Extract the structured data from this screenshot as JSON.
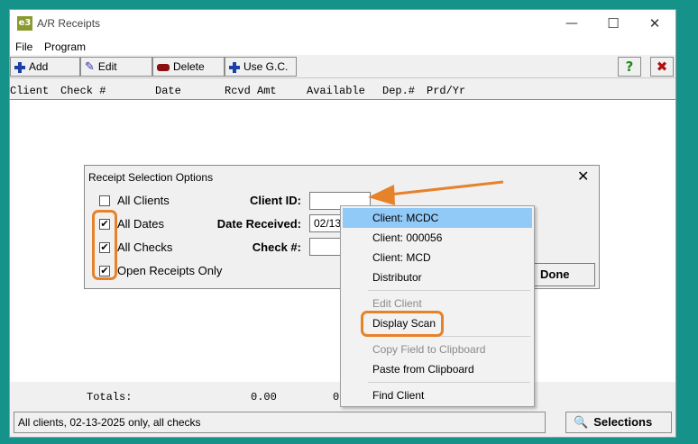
{
  "window": {
    "title": "A/R Receipts",
    "icon_text": "e3",
    "minimize": "—",
    "maximize": "☐",
    "close": "✕"
  },
  "menu": [
    "File",
    "Program"
  ],
  "toolbar": {
    "add": "Add",
    "edit": "Edit",
    "delete": "Delete",
    "use_gc": "Use G.C.",
    "help": "?",
    "exit": "✖"
  },
  "columns": [
    "Client",
    "Check #",
    "Date",
    "Rcvd Amt",
    "Available",
    "Dep.#",
    "Prd/Yr"
  ],
  "totals": {
    "label": "Totals:",
    "rcvd": "0.00",
    "available_partial": "0"
  },
  "status": {
    "text": "All clients, 02-13-2025 only, all checks",
    "selections": "Selections"
  },
  "dialog": {
    "title": "Receipt Selection Options",
    "close": "✕",
    "checkboxes": [
      {
        "label": "All Clients",
        "checked": false
      },
      {
        "label": "All Dates",
        "checked": true
      },
      {
        "label": "All Checks",
        "checked": true
      },
      {
        "label": "Open Receipts Only",
        "checked": true
      }
    ],
    "client_id_label": "Client ID:",
    "client_id_value": "",
    "date_received_label": "Date Received:",
    "date_received_value": "02/13",
    "check_label": "Check #:",
    "check_value": "",
    "done": "Done"
  },
  "context_menu": {
    "items": [
      {
        "label": "Client: MCDC",
        "state": "selected"
      },
      {
        "label": "Client: 000056",
        "state": "normal"
      },
      {
        "label": "Client: MCD",
        "state": "normal"
      },
      {
        "label": "Distributor",
        "state": "normal"
      },
      {
        "label": "Edit Client",
        "state": "disabled"
      },
      {
        "label": "Display Scan",
        "state": "normal"
      },
      {
        "label": "Copy Field to Clipboard",
        "state": "disabled"
      },
      {
        "label": "Paste from Clipboard",
        "state": "normal"
      },
      {
        "label": "Find Client",
        "state": "normal"
      }
    ]
  },
  "colors": {
    "background": "#15938b",
    "highlight": "#e6822a",
    "menu_selected": "#91c9f7"
  }
}
